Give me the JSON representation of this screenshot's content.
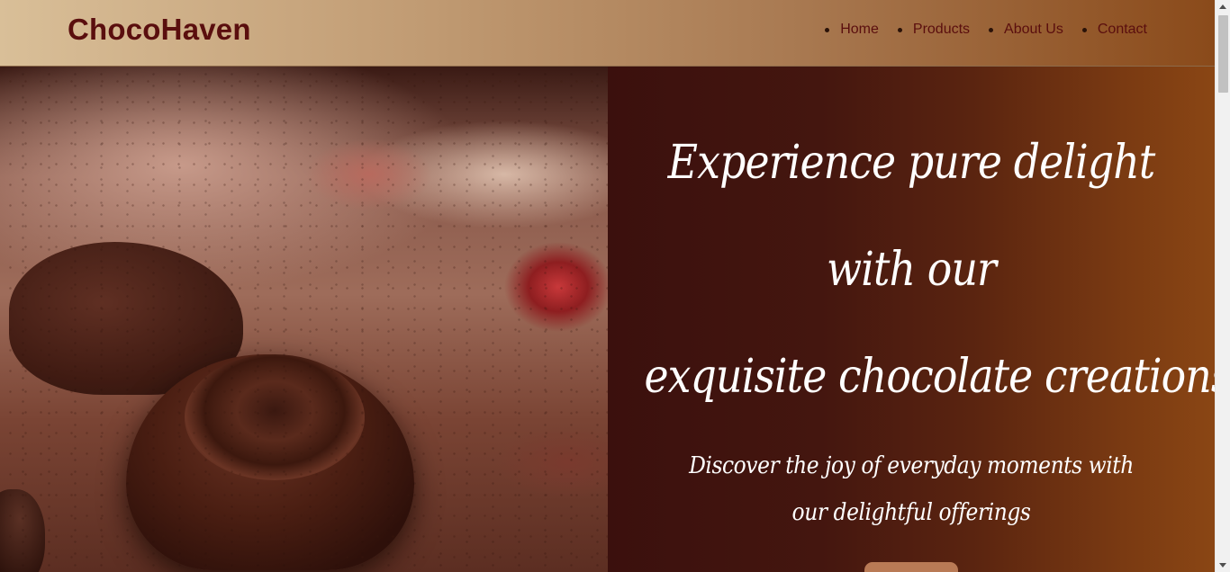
{
  "header": {
    "brand": "ChocoHaven",
    "nav": [
      {
        "label": "Home"
      },
      {
        "label": "Products"
      },
      {
        "label": "About Us"
      },
      {
        "label": "Contact"
      }
    ]
  },
  "hero": {
    "image_alt": "chocolate-truffles-photo",
    "headline_lines": [
      "Experience pure delight",
      "with our",
      "exquisite chocolate creations"
    ],
    "subheadline": "Discover the joy of everyday moments with our delightful offerings",
    "cta_label": ""
  },
  "colors": {
    "brand_text": "#5a0e0e",
    "hero_panel_start": "#3b100d",
    "hero_panel_end": "#8a4614",
    "cta_background": "#b97a55"
  }
}
